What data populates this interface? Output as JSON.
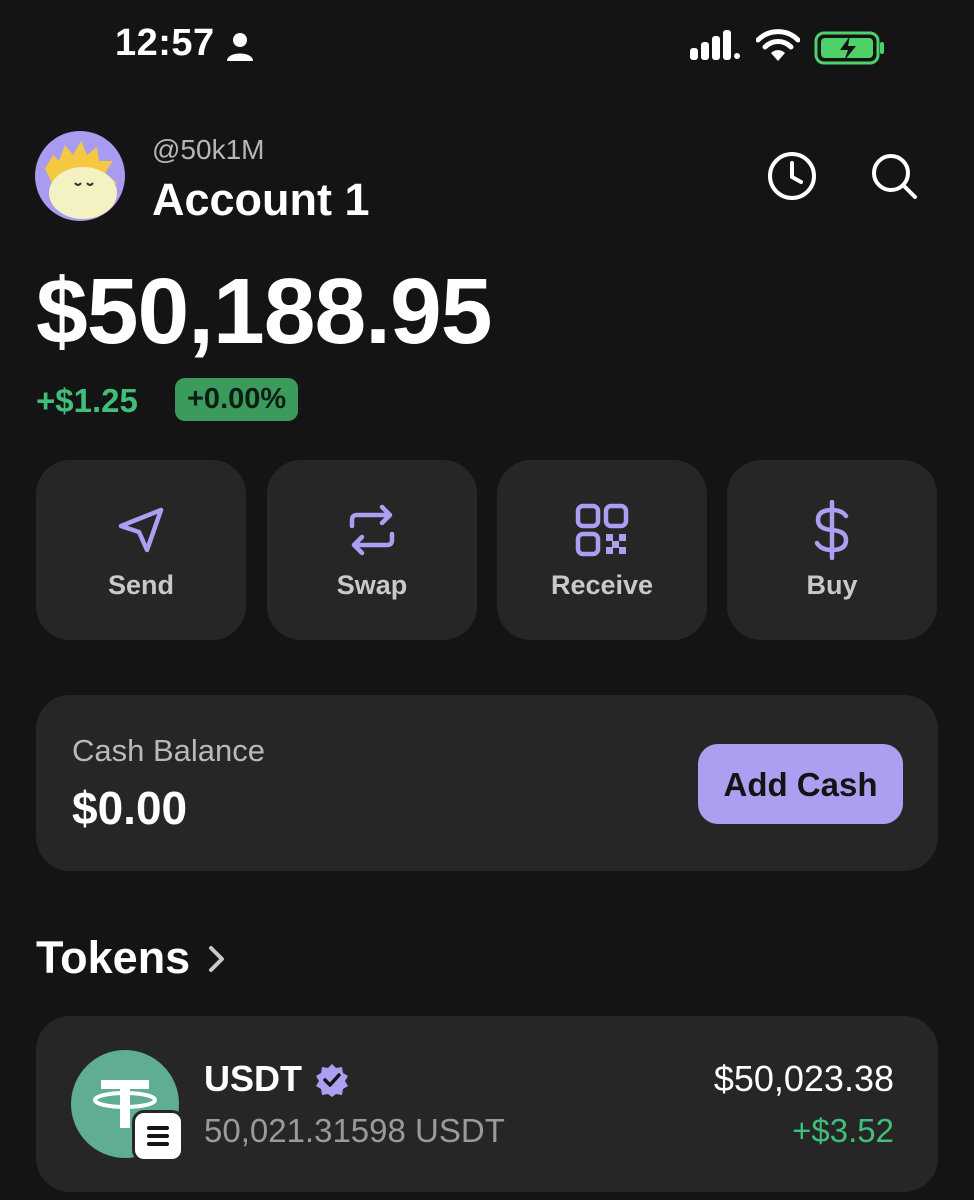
{
  "status_bar": {
    "time": "12:57",
    "icons": [
      "person-icon",
      "signal-icon",
      "wifi-icon",
      "battery-charging-icon"
    ]
  },
  "header": {
    "handle": "@50k1M",
    "account_name": "Account 1",
    "history_icon": "clock-icon",
    "search_icon": "search-icon"
  },
  "portfolio": {
    "balance": "$50,188.95",
    "change_amount": "+$1.25",
    "change_percent": "+0.00%"
  },
  "actions": [
    {
      "label": "Send",
      "icon": "send-icon"
    },
    {
      "label": "Swap",
      "icon": "swap-icon"
    },
    {
      "label": "Receive",
      "icon": "qr-code-icon"
    },
    {
      "label": "Buy",
      "icon": "dollar-icon"
    }
  ],
  "cash": {
    "label": "Cash Balance",
    "value": "$0.00",
    "button_label": "Add Cash"
  },
  "tokens": {
    "title": "Tokens",
    "items": [
      {
        "name": "USDT",
        "amount": "50,021.31598 USDT",
        "value": "$50,023.38",
        "change": "+$3.52",
        "icon": "tether-icon",
        "badge_icon": "solana-icon"
      }
    ]
  },
  "colors": {
    "background": "#141414",
    "card": "#262626",
    "accent": "#ab9ff2",
    "positive": "#3fbf7a"
  }
}
